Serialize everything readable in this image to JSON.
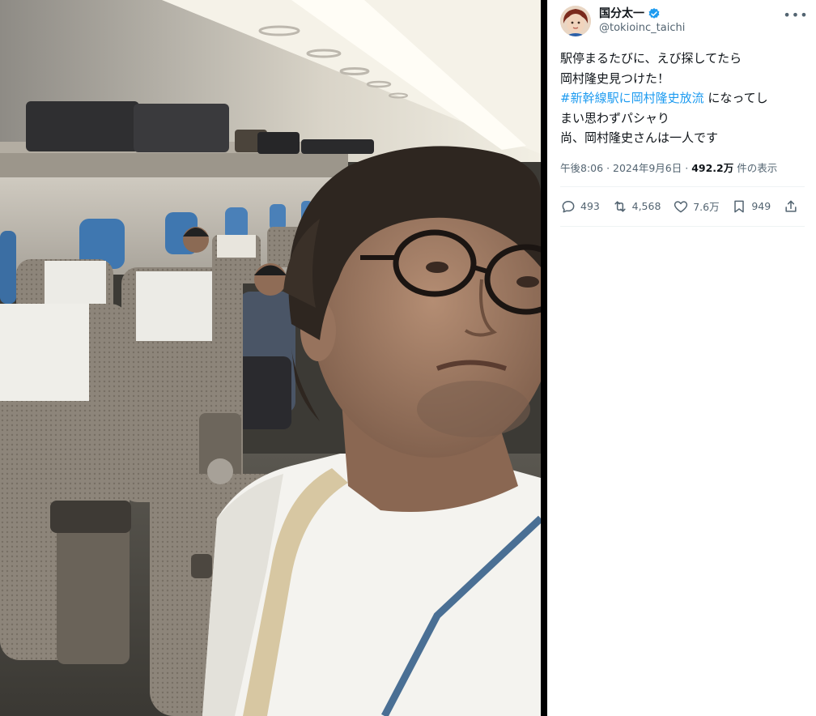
{
  "tweet": {
    "author_name": "国分太一",
    "handle": "@tokioinc_taichi",
    "more_label": "•••",
    "text_lines": [
      {
        "text": "駅停まるたびに、えび探してたら",
        "hashtag": "",
        "after": ""
      },
      {
        "text": "岡村隆史見つけた！",
        "hashtag": "",
        "after": ""
      },
      {
        "text": "",
        "hashtag": "#新幹線駅に岡村隆史放流",
        "after": " になってし"
      },
      {
        "text": "まい思わずパシャり",
        "hashtag": "",
        "after": ""
      },
      {
        "text": "尚、岡村隆史さんは一人です",
        "hashtag": "",
        "after": ""
      }
    ],
    "time": "午後8:06",
    "separator": "·",
    "date": "2024年9月6日",
    "views_count": "492.2万",
    "views_label": "件の表示",
    "actions": {
      "replies": "493",
      "retweets": "4,568",
      "likes": "7.6万",
      "bookmarks": "949"
    }
  },
  "colors": {
    "accent": "#1d9bf0",
    "text": "#0f1419",
    "muted": "#536471"
  },
  "icons": {
    "verified": "verified-badge-icon",
    "reply": "reply-icon",
    "retweet": "retweet-icon",
    "like": "heart-icon",
    "bookmark": "bookmark-icon",
    "share": "share-icon"
  }
}
